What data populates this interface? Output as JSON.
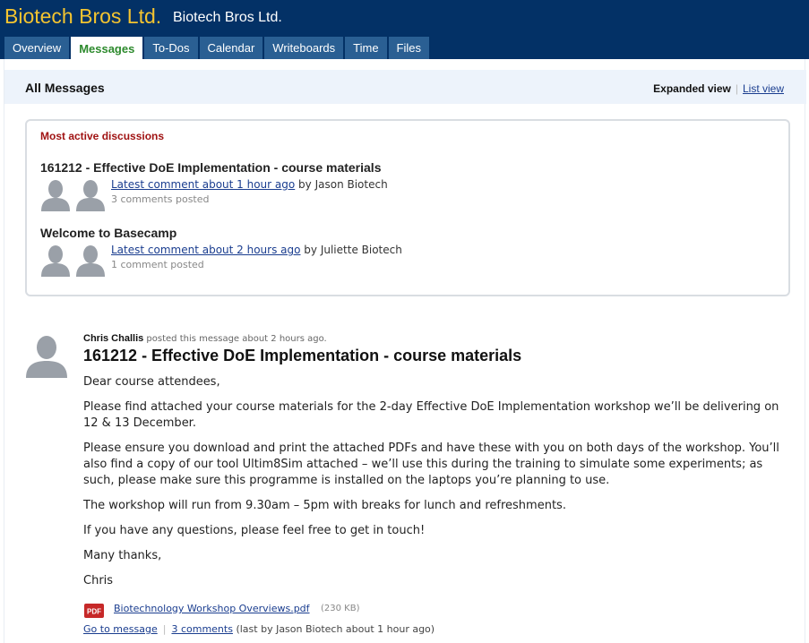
{
  "header": {
    "company": "Biotech Bros Ltd.",
    "project": "Biotech Bros Ltd."
  },
  "tabs": [
    {
      "label": "Overview",
      "active": false
    },
    {
      "label": "Messages",
      "active": true
    },
    {
      "label": "To-Dos",
      "active": false
    },
    {
      "label": "Calendar",
      "active": false
    },
    {
      "label": "Writeboards",
      "active": false
    },
    {
      "label": "Time",
      "active": false
    },
    {
      "label": "Files",
      "active": false
    }
  ],
  "page": {
    "title": "All Messages",
    "view_expanded": "Expanded view",
    "view_separator": "|",
    "view_list": "List view"
  },
  "active_discussions": {
    "heading": "Most active discussions",
    "items": [
      {
        "title": "161212 - Effective DoE Implementation - course materials",
        "latest_link": "Latest comment about 1 hour ago",
        "by_text": " by Jason Biotech",
        "count": "3 comments posted"
      },
      {
        "title": "Welcome to Basecamp",
        "latest_link": "Latest comment about 2 hours ago",
        "by_text": " by Juliette Biotech",
        "count": "1 comment posted"
      }
    ]
  },
  "message": {
    "author": "Chris Challis",
    "posted_text": " posted this message about 2 hours ago.",
    "title": "161212 - Effective DoE Implementation - course materials",
    "body": [
      "Dear course attendees,",
      "Please find attached your course materials for the 2-day Effective DoE Implementation workshop we’ll be delivering on 12 & 13 December.",
      "Please ensure you download and print the attached PDFs and have these with you on both days of the workshop. You’ll also find a copy of our tool Ultim8Sim attached – we’ll use this during the training to simulate some experiments; as such, please make sure this programme is installed on the laptops you’re planning to use.",
      "The workshop will run from 9.30am – 5pm with breaks for lunch and refreshments.",
      "If you have any questions, please feel free to get in touch!",
      "Many thanks,",
      "Chris"
    ],
    "attachment": {
      "icon": "pdf-icon",
      "icon_label": "PDF",
      "name": "Biotechnology Workshop Overviews.pdf",
      "size": "(230 KB)"
    },
    "footer": {
      "go_to_message": "Go to message",
      "separator": "|",
      "comments_link": "3 comments",
      "last_by": "(last by Jason Biotech about 1 hour ago)"
    }
  },
  "colors": {
    "header_bg": "#033166",
    "company_text": "#f4c430",
    "tab_bg": "#2a5f93",
    "tab_active_text": "#2d8a2d",
    "link": "#1a3d8f",
    "heading_red": "#a01313"
  }
}
